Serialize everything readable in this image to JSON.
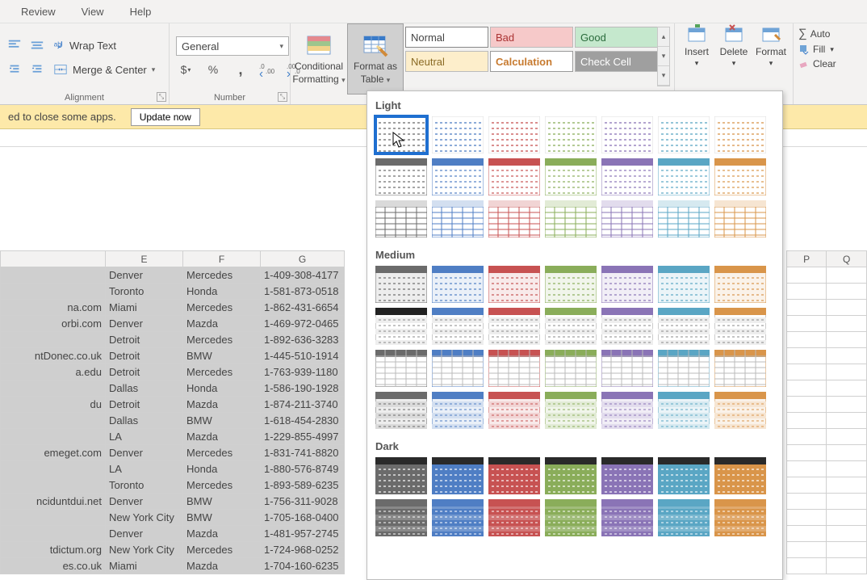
{
  "tabs": [
    "Review",
    "View",
    "Help"
  ],
  "ribbon": {
    "alignment": {
      "wrap": "Wrap Text",
      "merge": "Merge & Center",
      "label": "Alignment"
    },
    "number": {
      "format": "General",
      "label": "Number"
    },
    "cond": {
      "label1": "Conditional",
      "label2": "Formatting"
    },
    "fmttable": {
      "label1": "Format as",
      "label2": "Table"
    },
    "styles": {
      "r1": [
        "Normal",
        "Bad",
        "Good"
      ],
      "r2": [
        "Neutral",
        "Calculation",
        "Check Cell"
      ]
    },
    "cells": {
      "insert": "Insert",
      "delete": "Delete",
      "format": "Format"
    },
    "editing": {
      "autosum": "Auto",
      "fill": "Fill",
      "clear": "Clear"
    }
  },
  "msgbar": {
    "text": "ed to close some apps.",
    "btn": "Update now"
  },
  "columns_visible": [
    "E",
    "F",
    "G"
  ],
  "columns_empty": [
    "P",
    "Q"
  ],
  "rows": [
    {
      "d": "",
      "e": "Denver",
      "f": "Mercedes",
      "g": "1-409-308-4177"
    },
    {
      "d": "",
      "e": "Toronto",
      "f": "Honda",
      "g": "1-581-873-0518"
    },
    {
      "d": "na.com",
      "e": "Miami",
      "f": "Mercedes",
      "g": "1-862-431-6654"
    },
    {
      "d": "orbi.com",
      "e": "Denver",
      "f": "Mazda",
      "g": "1-469-972-0465"
    },
    {
      "d": "",
      "e": "Detroit",
      "f": "Mercedes",
      "g": "1-892-636-3283"
    },
    {
      "d": "ntDonec.co.uk",
      "e": "Detroit",
      "f": "BMW",
      "g": "1-445-510-1914"
    },
    {
      "d": "a.edu",
      "e": "Detroit",
      "f": "Mercedes",
      "g": "1-763-939-1180"
    },
    {
      "d": "",
      "e": "Dallas",
      "f": "Honda",
      "g": "1-586-190-1928"
    },
    {
      "d": "du",
      "e": "Detroit",
      "f": "Mazda",
      "g": "1-874-211-3740"
    },
    {
      "d": "",
      "e": "Dallas",
      "f": "BMW",
      "g": "1-618-454-2830"
    },
    {
      "d": "",
      "e": "LA",
      "f": "Mazda",
      "g": "1-229-855-4997"
    },
    {
      "d": "emeget.com",
      "e": "Denver",
      "f": "Mercedes",
      "g": "1-831-741-8820"
    },
    {
      "d": "",
      "e": "LA",
      "f": "Honda",
      "g": "1-880-576-8749"
    },
    {
      "d": "",
      "e": "Toronto",
      "f": "Mercedes",
      "g": "1-893-589-6235"
    },
    {
      "d": "nciduntdui.net",
      "e": "Denver",
      "f": "BMW",
      "g": "1-756-311-9028"
    },
    {
      "d": "",
      "e": "New York City",
      "f": "BMW",
      "g": "1-705-168-0400"
    },
    {
      "d": "",
      "e": "Denver",
      "f": "Mazda",
      "g": "1-481-957-2745"
    },
    {
      "d": "tdictum.org",
      "e": "New York City",
      "f": "Mercedes",
      "g": "1-724-968-0252"
    },
    {
      "d": "es.co.uk",
      "e": "Miami",
      "f": "Mazda",
      "g": "1-704-160-6235"
    }
  ],
  "gallery": {
    "sections": [
      "Light",
      "Medium",
      "Dark"
    ],
    "palette": [
      "#6b6b6b",
      "#4f7ec4",
      "#c75252",
      "#8aad5a",
      "#8a74b6",
      "#5aa6c4",
      "#d9954a"
    ],
    "light_rows": 3,
    "medium_rows": 4,
    "dark_rows": 2,
    "selected_index": 0
  }
}
